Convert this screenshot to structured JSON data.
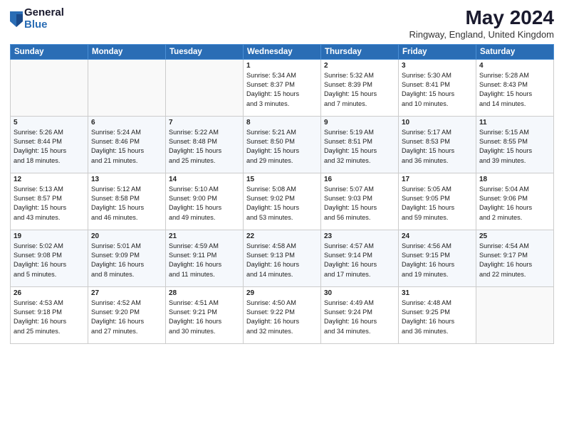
{
  "header": {
    "logo_general": "General",
    "logo_blue": "Blue",
    "title": "May 2024",
    "subtitle": "Ringway, England, United Kingdom"
  },
  "days_of_week": [
    "Sunday",
    "Monday",
    "Tuesday",
    "Wednesday",
    "Thursday",
    "Friday",
    "Saturday"
  ],
  "weeks": [
    [
      {
        "day": "",
        "info": ""
      },
      {
        "day": "",
        "info": ""
      },
      {
        "day": "",
        "info": ""
      },
      {
        "day": "1",
        "info": "Sunrise: 5:34 AM\nSunset: 8:37 PM\nDaylight: 15 hours\nand 3 minutes."
      },
      {
        "day": "2",
        "info": "Sunrise: 5:32 AM\nSunset: 8:39 PM\nDaylight: 15 hours\nand 7 minutes."
      },
      {
        "day": "3",
        "info": "Sunrise: 5:30 AM\nSunset: 8:41 PM\nDaylight: 15 hours\nand 10 minutes."
      },
      {
        "day": "4",
        "info": "Sunrise: 5:28 AM\nSunset: 8:43 PM\nDaylight: 15 hours\nand 14 minutes."
      }
    ],
    [
      {
        "day": "5",
        "info": "Sunrise: 5:26 AM\nSunset: 8:44 PM\nDaylight: 15 hours\nand 18 minutes."
      },
      {
        "day": "6",
        "info": "Sunrise: 5:24 AM\nSunset: 8:46 PM\nDaylight: 15 hours\nand 21 minutes."
      },
      {
        "day": "7",
        "info": "Sunrise: 5:22 AM\nSunset: 8:48 PM\nDaylight: 15 hours\nand 25 minutes."
      },
      {
        "day": "8",
        "info": "Sunrise: 5:21 AM\nSunset: 8:50 PM\nDaylight: 15 hours\nand 29 minutes."
      },
      {
        "day": "9",
        "info": "Sunrise: 5:19 AM\nSunset: 8:51 PM\nDaylight: 15 hours\nand 32 minutes."
      },
      {
        "day": "10",
        "info": "Sunrise: 5:17 AM\nSunset: 8:53 PM\nDaylight: 15 hours\nand 36 minutes."
      },
      {
        "day": "11",
        "info": "Sunrise: 5:15 AM\nSunset: 8:55 PM\nDaylight: 15 hours\nand 39 minutes."
      }
    ],
    [
      {
        "day": "12",
        "info": "Sunrise: 5:13 AM\nSunset: 8:57 PM\nDaylight: 15 hours\nand 43 minutes."
      },
      {
        "day": "13",
        "info": "Sunrise: 5:12 AM\nSunset: 8:58 PM\nDaylight: 15 hours\nand 46 minutes."
      },
      {
        "day": "14",
        "info": "Sunrise: 5:10 AM\nSunset: 9:00 PM\nDaylight: 15 hours\nand 49 minutes."
      },
      {
        "day": "15",
        "info": "Sunrise: 5:08 AM\nSunset: 9:02 PM\nDaylight: 15 hours\nand 53 minutes."
      },
      {
        "day": "16",
        "info": "Sunrise: 5:07 AM\nSunset: 9:03 PM\nDaylight: 15 hours\nand 56 minutes."
      },
      {
        "day": "17",
        "info": "Sunrise: 5:05 AM\nSunset: 9:05 PM\nDaylight: 15 hours\nand 59 minutes."
      },
      {
        "day": "18",
        "info": "Sunrise: 5:04 AM\nSunset: 9:06 PM\nDaylight: 16 hours\nand 2 minutes."
      }
    ],
    [
      {
        "day": "19",
        "info": "Sunrise: 5:02 AM\nSunset: 9:08 PM\nDaylight: 16 hours\nand 5 minutes."
      },
      {
        "day": "20",
        "info": "Sunrise: 5:01 AM\nSunset: 9:09 PM\nDaylight: 16 hours\nand 8 minutes."
      },
      {
        "day": "21",
        "info": "Sunrise: 4:59 AM\nSunset: 9:11 PM\nDaylight: 16 hours\nand 11 minutes."
      },
      {
        "day": "22",
        "info": "Sunrise: 4:58 AM\nSunset: 9:13 PM\nDaylight: 16 hours\nand 14 minutes."
      },
      {
        "day": "23",
        "info": "Sunrise: 4:57 AM\nSunset: 9:14 PM\nDaylight: 16 hours\nand 17 minutes."
      },
      {
        "day": "24",
        "info": "Sunrise: 4:56 AM\nSunset: 9:15 PM\nDaylight: 16 hours\nand 19 minutes."
      },
      {
        "day": "25",
        "info": "Sunrise: 4:54 AM\nSunset: 9:17 PM\nDaylight: 16 hours\nand 22 minutes."
      }
    ],
    [
      {
        "day": "26",
        "info": "Sunrise: 4:53 AM\nSunset: 9:18 PM\nDaylight: 16 hours\nand 25 minutes."
      },
      {
        "day": "27",
        "info": "Sunrise: 4:52 AM\nSunset: 9:20 PM\nDaylight: 16 hours\nand 27 minutes."
      },
      {
        "day": "28",
        "info": "Sunrise: 4:51 AM\nSunset: 9:21 PM\nDaylight: 16 hours\nand 30 minutes."
      },
      {
        "day": "29",
        "info": "Sunrise: 4:50 AM\nSunset: 9:22 PM\nDaylight: 16 hours\nand 32 minutes."
      },
      {
        "day": "30",
        "info": "Sunrise: 4:49 AM\nSunset: 9:24 PM\nDaylight: 16 hours\nand 34 minutes."
      },
      {
        "day": "31",
        "info": "Sunrise: 4:48 AM\nSunset: 9:25 PM\nDaylight: 16 hours\nand 36 minutes."
      },
      {
        "day": "",
        "info": ""
      }
    ]
  ]
}
